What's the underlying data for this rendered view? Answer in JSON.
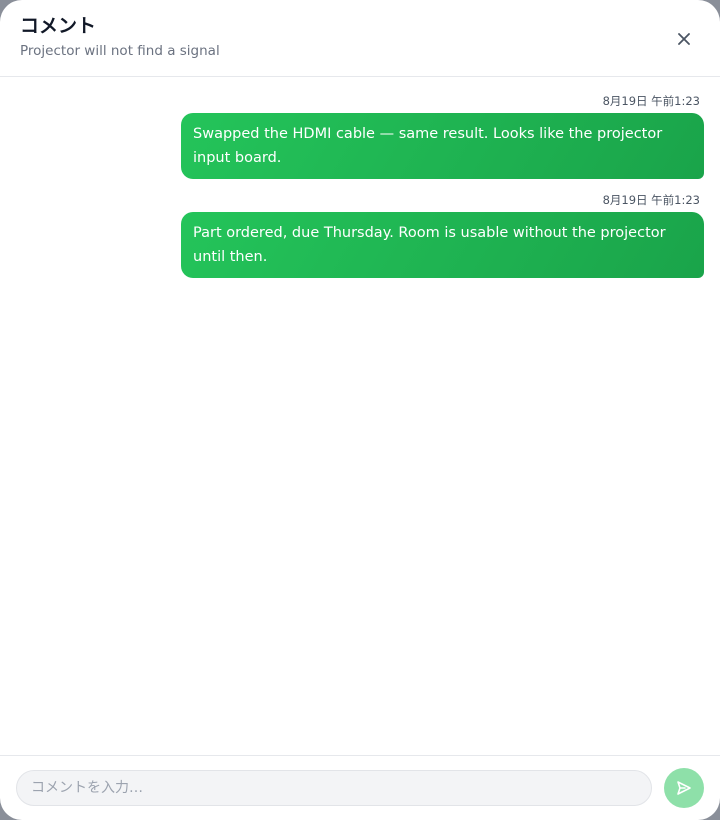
{
  "header": {
    "title": "コメント",
    "subtitle": "Projector will not find a signal",
    "close_icon": "close-icon"
  },
  "messages": [
    {
      "timestamp": "8月19日 午前1:23",
      "text": "Swapped the HDMI cable — same result. Looks like the projector input board."
    },
    {
      "timestamp": "8月19日 午前1:23",
      "text": "Part ordered, due Thursday. Room is usable without the projector until then."
    }
  ],
  "composer": {
    "placeholder": "コメントを入力…",
    "value": "",
    "send_icon": "send-icon"
  },
  "colors": {
    "bubble": "#22c55e",
    "send_button": "#8ee0a9"
  }
}
